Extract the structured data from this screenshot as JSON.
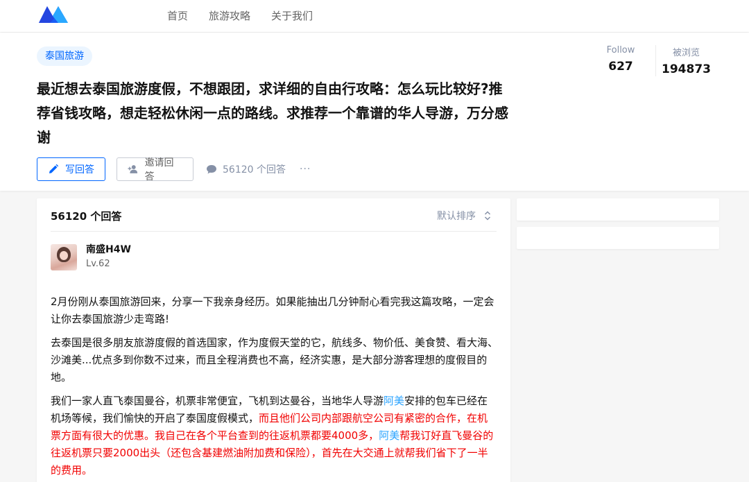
{
  "nav": {
    "items": [
      "首页",
      "旅游攻略",
      "关于我们"
    ]
  },
  "question": {
    "topic": "泰国旅游",
    "title": "最近想去泰国旅游度假，不想跟团，求详细的自由行攻略：怎么玩比较好?推荐省钱攻略，想走轻松休闲一点的路线。求推荐一个靠谱的华人导游，万分感谢",
    "stats": [
      {
        "label": "Follow",
        "value": "627"
      },
      {
        "label": "被浏览",
        "value": "194873"
      }
    ],
    "write_answer": "写回答",
    "invite_answer": "邀请回答",
    "comment_count": "56120 个回答",
    "more": "···"
  },
  "answers": {
    "count_label": "56120 个回答",
    "sort_label": "默认排序",
    "author": {
      "name": "南盛H4W",
      "level": "Lv.62"
    },
    "paragraphs": [
      [
        {
          "t": "2月份刚从泰国旅游回来，分享一下我亲身经历。如果能抽出几分钟耐心看完我这篇攻略，一定会让你去泰国旅游少走弯路!",
          "s": ""
        }
      ],
      [
        {
          "t": "去泰国是很多朋友旅游度假的首选国家，作为度假天堂的它，航线多、物价低、美食赞、看大海、沙滩美...优点多到你数不过来，而且全程消费也不高，经济实惠，是大部分游客理想的度假目的地。",
          "s": ""
        }
      ],
      [
        {
          "t": "我们一家人直飞泰国曼谷，机票非常便宜，飞机到达曼谷，当地华人导游",
          "s": ""
        },
        {
          "t": "阿美",
          "s": "blue"
        },
        {
          "t": "安排的包车已经在机场等候，我们愉快的开启了泰国度假模式，",
          "s": ""
        },
        {
          "t": "而且他们公司内部跟航空公司有紧密的合作，在机票方面有很大的优惠。我自己在各个平台查到的往返机票都要4000多，",
          "s": "red"
        },
        {
          "t": "阿美",
          "s": "blue"
        },
        {
          "t": "帮我订好直飞曼谷的往返机票只要2000出头（还包含基建燃油附加费和保险），首先在大交通上就帮我们省下了一半的费用。",
          "s": "red"
        }
      ]
    ]
  },
  "colors": {
    "accent": "#0066ff",
    "highlight_blue": "#2aa3ff",
    "highlight_red": "#f10000"
  }
}
